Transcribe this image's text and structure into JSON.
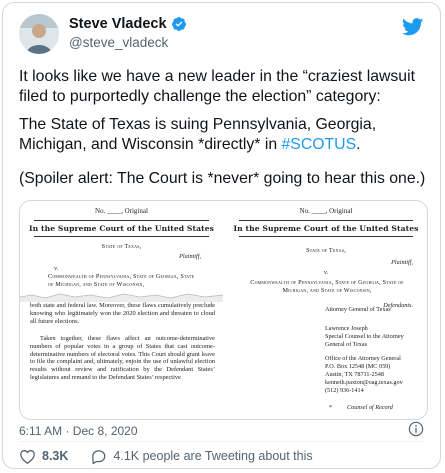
{
  "tweet": {
    "display_name": "Steve Vladeck",
    "handle": "@steve_vladeck",
    "text_1": "It looks like we have a new leader in the “craziest lawsuit filed to purportedly challenge the election” category:",
    "text_2_prefix": "The State of Texas is suing Pennsylvania, Georgia, Michigan, and Wisconsin *directly* in ",
    "text_2_hashtag": "#SCOTUS",
    "text_2_suffix": ".",
    "text_3": "(Spoiler alert: The Court is *never* going to hear this one.)",
    "timestamp": "6:11 AM · Dec 8, 2020",
    "like_count": "8.3K",
    "people_tweeting": "4.1K people are Tweeting about this"
  },
  "document_left": {
    "number_line": "No. ____, Original",
    "court": "In the Supreme Court of the United States",
    "party_state": "State of Texas,",
    "plaintiff": "Plaintiff,",
    "versus": "v.",
    "defendants": "Commonwealth of Pennsylvania, State of Georgia, State of Michigan, and State of Wisconsin,",
    "defendants_short": "Defendants.",
    "body_1": "both state and federal law. Moreover, these flaws cumulatively preclude knowing who legitimately won the 2020 election and threaten to cloud all future elections.",
    "body_2": "Taken together, these flaws affect an outcome-determinative numbers of popular votes in a group of States that cast outcome-determinative numbers of electoral votes. This Court should grant leave to file the complaint and, ultimately, enjoin the use of unlawful election results without review and ratification by the Defendant States’ legislatures and remand to the Defendant States’ respective"
  },
  "document_right": {
    "number_line": "No. ____, Original",
    "court": "In the Supreme Court of the United States",
    "party_state": "State of Texas,",
    "plaintiff": "Plaintiff,",
    "versus": "v.",
    "defendants": "Commonwealth of Pennsylvania, State of Georgia, State of Michigan, and State of Wisconsin,",
    "defendants_short": "Defendants.",
    "ag_name": "Ken Paxton*",
    "ag_title": "Attorney General of Texas",
    "counsel_name": "Lawrence Joseph",
    "counsel_title": "Special Counsel to the Attorney General of Texas",
    "office": "Office of the Attorney General",
    "address_1": "P.O. Box 12548 (MC 059)",
    "address_2": "Austin, TX 78711-2548",
    "email": "kenneth.paxton@oag.texas.gov",
    "phone": "(512) 936-1414",
    "star": "*",
    "counsel_of_record": "Counsel of Record"
  },
  "colors": {
    "accent": "#1d9bf0",
    "secondary_text": "#536471"
  }
}
